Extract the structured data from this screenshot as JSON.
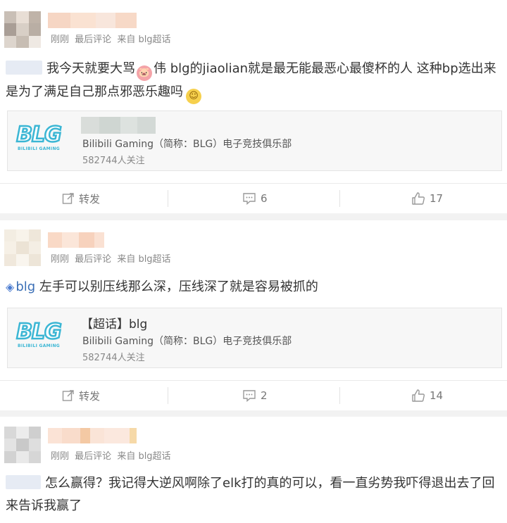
{
  "posts": [
    {
      "meta": {
        "time": "刚刚",
        "tag": "最后评论",
        "source": "来自 blg超话"
      },
      "text_before_emoji": "我今天就要大骂",
      "text_after_emoji": "伟 blg的jiaolian就是最无能最恶心最傻杯的人 这种bp选出来是为了满足自己那点邪恶乐趣吗",
      "card": {
        "logo_text": "BLG",
        "logo_subtext": "BILIBILI GAMING",
        "description": "Bilibili Gaming（简称：BLG）电子竞技俱乐部",
        "followers": "582744人关注"
      },
      "actions": {
        "repost_label": "转发",
        "comment_count": "6",
        "like_count": "17"
      }
    },
    {
      "meta": {
        "time": "刚刚",
        "tag": "最后评论",
        "source": "来自 blg超话"
      },
      "topic_link": "blg",
      "text": " 左手可以别压线那么深，压线深了就是容易被抓的",
      "card": {
        "title": "【超话】blg",
        "logo_text": "BLG",
        "logo_subtext": "BILIBILI GAMING",
        "description": "Bilibili Gaming（简称：BLG）电子竞技俱乐部",
        "followers": "582744人关注"
      },
      "actions": {
        "repost_label": "转发",
        "comment_count": "2",
        "like_count": "14"
      }
    },
    {
      "meta": {
        "time": "刚刚",
        "tag": "最后评论",
        "source": "来自 blg超话"
      },
      "text": "怎么赢得？我记得大逆风啊除了elk打的真的可以，看一直劣势我吓得退出去了回来告诉我赢了"
    }
  ],
  "icons": {
    "repost": "repost-icon",
    "comment": "comment-icon",
    "like": "like-icon",
    "pig_emoji": "pig-emoji-icon",
    "smile_emoji": "smile-emoji-icon",
    "diamond": "diamond-icon"
  },
  "colors": {
    "link": "#3b6fb6",
    "logo": "#3bb6d4",
    "meta": "#888888"
  }
}
